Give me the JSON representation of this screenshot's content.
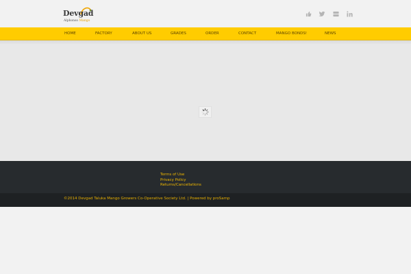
{
  "header": {
    "logo_main": "Devgad",
    "logo_sub_left": "Alphonso",
    "logo_sub_right": "Mango",
    "social_icons": [
      "thumbs-up-icon",
      "twitter-icon",
      "youtube-icon",
      "linkedin-icon"
    ]
  },
  "nav": {
    "items": [
      {
        "label": "HOME"
      },
      {
        "label": "FACTORY"
      },
      {
        "label": "ABOUT US"
      },
      {
        "label": "GRADES"
      },
      {
        "label": "ORDER"
      },
      {
        "label": "CONTACT"
      },
      {
        "label": "MANGO BONDS!"
      },
      {
        "label": "NEWS"
      }
    ]
  },
  "footer": {
    "links": [
      {
        "label": "Terms of Use"
      },
      {
        "label": "Privacy Policy"
      },
      {
        "label": "Returns/Cancellations"
      }
    ],
    "copyright": "©2014 Devgad Taluka Mango Growers Co-Operative Society Ltd. | Powered by proSamp"
  },
  "colors": {
    "accent": "#ffcc00",
    "footer_bg": "#272b2e",
    "footer_link": "#f0b800"
  }
}
